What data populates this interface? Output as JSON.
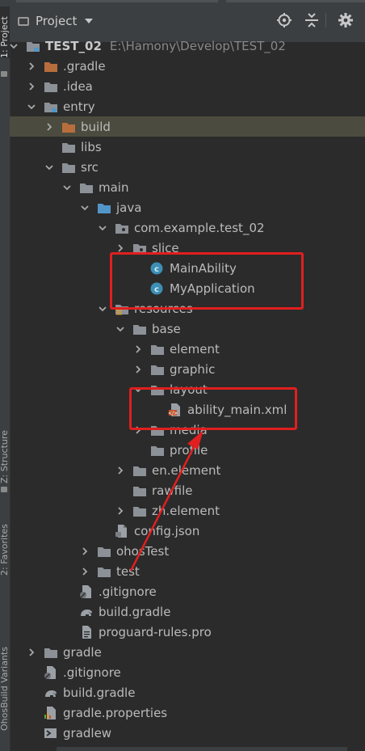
{
  "side_tabs": {
    "project": "1: Project",
    "structure": "Z: Structure",
    "favorites": "2: Favorites",
    "variants": "OhosBuild Variants"
  },
  "toolbar": {
    "view_label": "Project",
    "locate_icon": "crosshair-icon",
    "collapse_icon": "collapse-all-icon",
    "settings_icon": "gear-icon"
  },
  "tree": [
    {
      "label": "TEST_02",
      "path": "E:\\Hamony\\Develop\\TEST_02",
      "icon": "module-folder",
      "expanded": true
    },
    {
      "label": ".gradle",
      "icon": "folder-orange",
      "expanded": false
    },
    {
      "label": ".idea",
      "icon": "folder",
      "expanded": false
    },
    {
      "label": "entry",
      "icon": "module-folder",
      "expanded": true
    },
    {
      "label": "build",
      "icon": "folder-orange",
      "expanded": false
    },
    {
      "label": "libs",
      "icon": "folder"
    },
    {
      "label": "src",
      "icon": "folder",
      "expanded": true
    },
    {
      "label": "main",
      "icon": "folder",
      "expanded": true
    },
    {
      "label": "java",
      "icon": "folder-blue",
      "expanded": true
    },
    {
      "label": "com.example.test_02",
      "icon": "package",
      "expanded": true
    },
    {
      "label": "slice",
      "icon": "package",
      "expanded": false
    },
    {
      "label": "MainAbility",
      "icon": "class"
    },
    {
      "label": "MyApplication",
      "icon": "class"
    },
    {
      "label": "resources",
      "icon": "folder-res",
      "expanded": true
    },
    {
      "label": "base",
      "icon": "folder",
      "expanded": true
    },
    {
      "label": "element",
      "icon": "folder",
      "expanded": false
    },
    {
      "label": "graphic",
      "icon": "folder",
      "expanded": false
    },
    {
      "label": "layout",
      "icon": "folder",
      "expanded": true
    },
    {
      "label": "ability_main.xml",
      "icon": "xml-file"
    },
    {
      "label": "media",
      "icon": "folder",
      "expanded": false
    },
    {
      "label": "profile",
      "icon": "folder"
    },
    {
      "label": "en.element",
      "icon": "folder",
      "expanded": false
    },
    {
      "label": "rawfile",
      "icon": "folder"
    },
    {
      "label": "zh.element",
      "icon": "folder",
      "expanded": false
    },
    {
      "label": "config.json",
      "icon": "json-file"
    },
    {
      "label": "ohosTest",
      "icon": "folder",
      "expanded": false
    },
    {
      "label": "test",
      "icon": "folder",
      "expanded": false
    },
    {
      "label": ".gitignore",
      "icon": "ignore-file"
    },
    {
      "label": "build.gradle",
      "icon": "gradle-file"
    },
    {
      "label": "proguard-rules.pro",
      "icon": "text-file"
    },
    {
      "label": "gradle",
      "icon": "folder",
      "expanded": false
    },
    {
      "label": ".gitignore",
      "icon": "ignore-file"
    },
    {
      "label": "build.gradle",
      "icon": "gradle-file"
    },
    {
      "label": "gradle.properties",
      "icon": "properties-file"
    },
    {
      "label": "gradlew",
      "icon": "shell-file"
    }
  ],
  "colors": {
    "background": "#2b2b2b",
    "selection": "#4c4b3f",
    "annotation": "#e11f1f",
    "folder": "#8c9197",
    "folder_orange": "#b86e3c",
    "folder_blue": "#5296c9",
    "class_icon": "#3d8fb5"
  }
}
